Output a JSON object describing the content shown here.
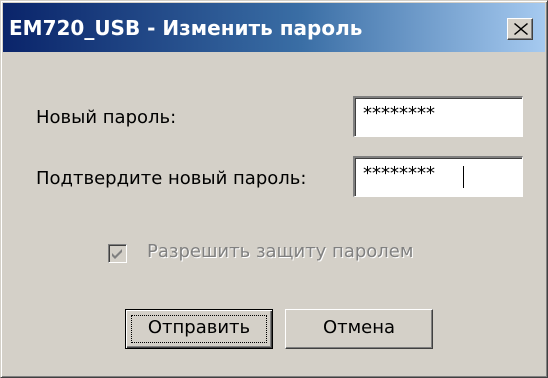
{
  "window": {
    "title": "EM720_USB - Изменить пароль",
    "close_label": "X"
  },
  "form": {
    "new_password_label": "Новый пароль:",
    "new_password_value": "********",
    "confirm_password_label": "Подтвердите новый пароль:",
    "confirm_password_value": "********"
  },
  "options": {
    "enable_protection_label": "Разрешить защиту паролем",
    "enable_protection_checked": true,
    "enable_protection_disabled": true
  },
  "buttons": {
    "submit_label": "Отправить",
    "cancel_label": "Отмена"
  },
  "colors": {
    "title_gradient_start": "#0a246a",
    "title_gradient_end": "#a6caf0",
    "face": "#d4d0c8",
    "disabled_text": "#808080"
  },
  "icons": {
    "close": "close-x-icon",
    "checkbox_mark": "checkmark-icon"
  }
}
